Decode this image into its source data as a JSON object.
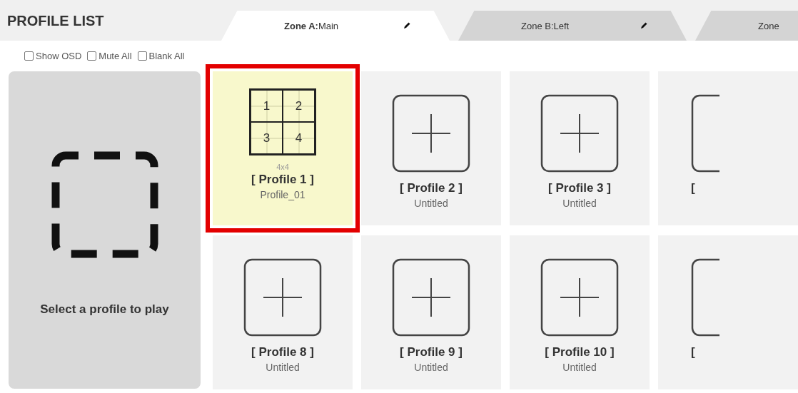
{
  "title": "PROFILE LIST",
  "tabs": [
    {
      "label": "**Zone A:**Main",
      "selected": true,
      "editable": true
    },
    {
      "label": "Zone B:Left",
      "selected": false,
      "editable": true
    },
    {
      "label": "Zone",
      "selected": false
    }
  ],
  "options": [
    {
      "label": "Show OSD",
      "checked": false
    },
    {
      "label": "Mute All",
      "checked": false
    },
    {
      "label": "Blank All",
      "checked": false
    }
  ],
  "player": {
    "message": "Select a profile to play"
  },
  "profiles": [
    {
      "kind": "layout",
      "name": "[ Profile 1 ]",
      "subtitle": "Profile_01",
      "size": "4x4",
      "cells": [
        "1",
        "2",
        "3",
        "4"
      ],
      "selected": true
    },
    {
      "kind": "empty",
      "name": "[ Profile 2 ]",
      "subtitle": "Untitled",
      "selected": false
    },
    {
      "kind": "empty",
      "name": "[ Profile 3 ]",
      "subtitle": "Untitled",
      "selected": false
    },
    {
      "kind": "partial",
      "name": "[",
      "selected": false
    },
    {
      "kind": "empty",
      "name": "[ Profile 8 ]",
      "subtitle": "Untitled",
      "selected": false
    },
    {
      "kind": "empty",
      "name": "[ Profile 9 ]",
      "subtitle": "Untitled",
      "selected": false
    },
    {
      "kind": "empty",
      "name": "[ Profile 10 ]",
      "subtitle": "Untitled",
      "selected": false
    },
    {
      "kind": "partial",
      "name": "[",
      "selected": false
    }
  ]
}
